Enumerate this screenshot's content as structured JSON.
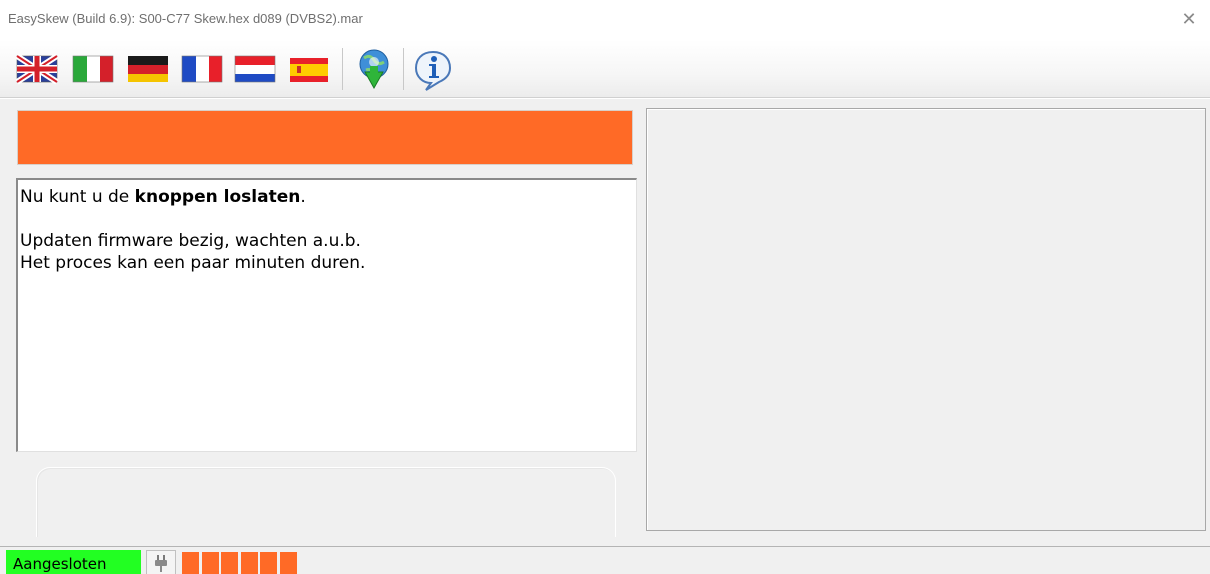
{
  "window": {
    "title": "EasySkew (Build 6.9): S00-C77 Skew.hex d089 (DVBS2).mar",
    "close_glyph": "✕"
  },
  "toolbar": {
    "buttons": [
      {
        "name": "flag-uk-icon",
        "tooltip": "English"
      },
      {
        "name": "flag-italy-icon",
        "tooltip": "Italiano"
      },
      {
        "name": "flag-germany-icon",
        "tooltip": "Deutsch"
      },
      {
        "name": "flag-france-icon",
        "tooltip": "Français"
      },
      {
        "name": "flag-netherlands-icon",
        "tooltip": "Nederlands"
      },
      {
        "name": "flag-spain-icon",
        "tooltip": "Español"
      },
      {
        "name": "globe-download-icon",
        "tooltip": ""
      },
      {
        "name": "info-icon",
        "tooltip": ""
      }
    ]
  },
  "status_indicator": {
    "color": "#ff6a26"
  },
  "message": {
    "line1_prefix": "Nu kunt u de ",
    "line1_bold": "knoppen loslaten",
    "line1_suffix": ".",
    "line2": "Updaten firmware bezig, wachten a.u.b.",
    "line3": "Het proces kan een paar minuten duren."
  },
  "statusbar": {
    "connection_label": "Aangesloten",
    "connection_color": "#22ff22",
    "plug_icon": "plug-icon",
    "progress_segments_filled": 6,
    "progress_color": "#ff6a26"
  }
}
